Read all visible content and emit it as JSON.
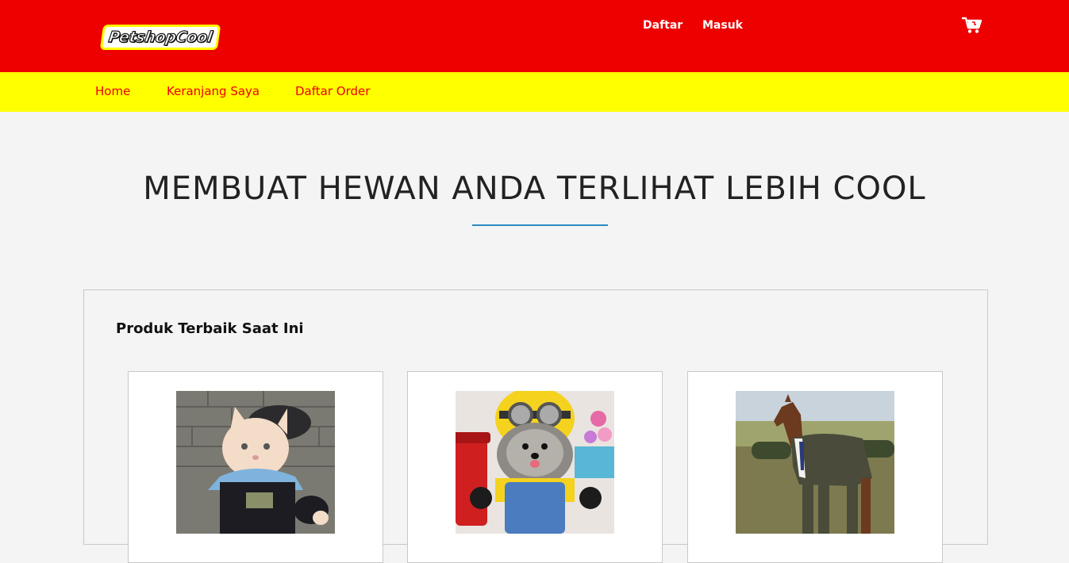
{
  "header": {
    "logo_text": "PetshopCool",
    "auth_links": [
      "Daftar",
      "Masuk"
    ],
    "cart_icon": "cart-icon"
  },
  "nav": {
    "items": [
      "Home",
      "Keranjang Saya",
      "Daftar Order"
    ]
  },
  "hero": {
    "title": "MEMBUAT HEWAN ANDA TERLIHAT LEBIH COOL"
  },
  "products": {
    "section_title": "Produk Terbaik Saat Ini",
    "items": [
      {
        "image": "cat-costume-photo"
      },
      {
        "image": "minion-dog-photo"
      },
      {
        "image": "horse-suit-photo"
      }
    ]
  },
  "colors": {
    "topbar": "#ee0000",
    "navbar": "#ffff00",
    "nav_text": "#ee0000",
    "accent_line": "#2a8bbf",
    "background": "#f4f4f4"
  }
}
